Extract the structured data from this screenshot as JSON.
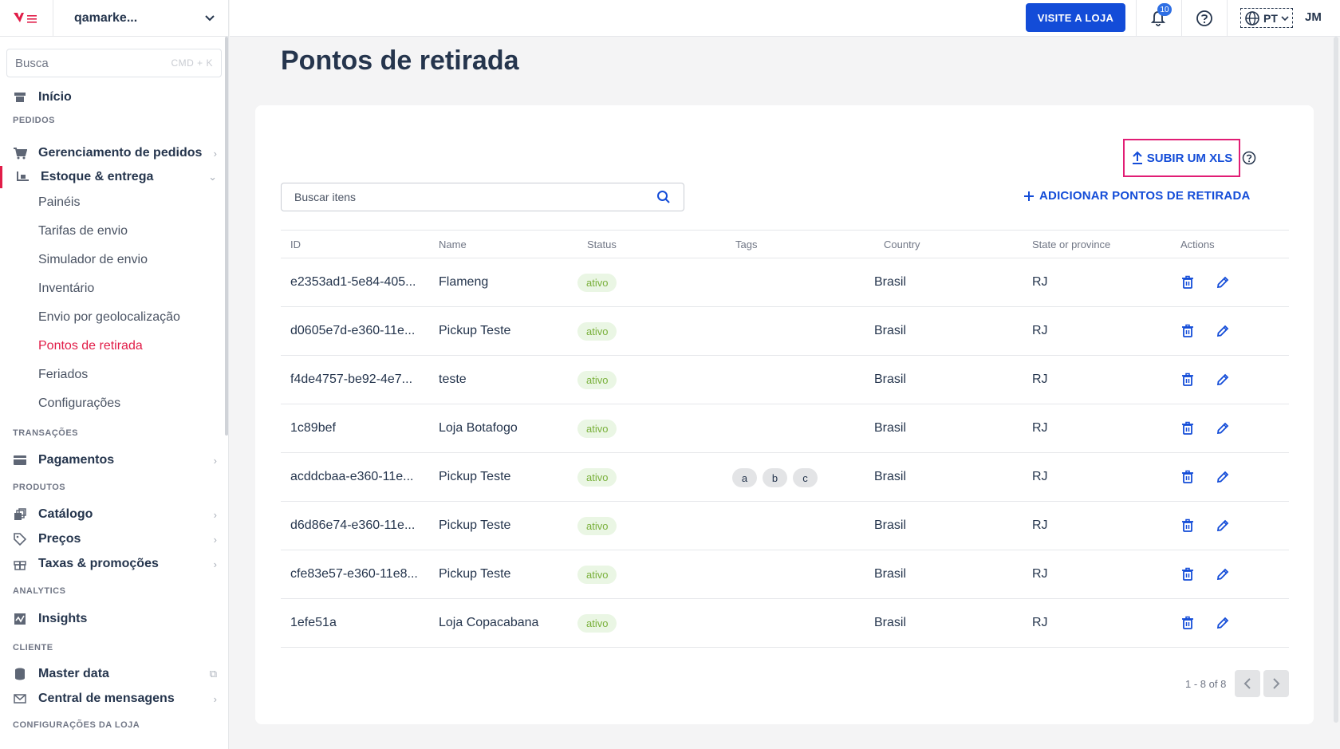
{
  "account": {
    "name": "qamarke..."
  },
  "sidebar": {
    "search_placeholder": "Busca",
    "search_shortcut": "CMD + K",
    "home": "Início",
    "sections": {
      "pedidos": "PEDIDOS",
      "transacoes": "TRANSAÇÕES",
      "produtos": "PRODUTOS",
      "analytics": "ANALYTICS",
      "cliente": "CLIENTE",
      "config_loja": "CONFIGURAÇÕES DA LOJA"
    },
    "items": {
      "orders": "Gerenciamento de pedidos",
      "stock": "Estoque & entrega",
      "payments": "Pagamentos",
      "catalog": "Catálogo",
      "prices": "Preços",
      "taxes": "Taxas & promoções",
      "insights": "Insights",
      "masterdata": "Master data",
      "messages": "Central de mensagens"
    },
    "sub_items": {
      "panels": "Painéis",
      "rates": "Tarifas de envio",
      "simulator": "Simulador de envio",
      "inventory": "Inventário",
      "geo": "Envio por geolocalização",
      "pickup": "Pontos de retirada",
      "holidays": "Feriados",
      "settings": "Configurações"
    }
  },
  "topbar": {
    "visit_store": "VISITE A LOJA",
    "notifications_count": "10",
    "language": "PT",
    "avatar": "JM"
  },
  "main": {
    "title": "Pontos de retirada",
    "upload_label": "SUBIR UM XLS",
    "search_placeholder": "Buscar itens",
    "add_label": "ADICIONAR PONTOS DE RETIRADA",
    "columns": {
      "id": "ID",
      "name": "Name",
      "status": "Status",
      "tags": "Tags",
      "country": "Country",
      "state": "State or province",
      "actions": "Actions"
    },
    "rows": [
      {
        "id": "e2353ad1-5e84-405...",
        "name": "Flameng",
        "status": "ativo",
        "tags": [],
        "country": "Brasil",
        "state": "RJ"
      },
      {
        "id": "d0605e7d-e360-11e...",
        "name": "Pickup Teste",
        "status": "ativo",
        "tags": [],
        "country": "Brasil",
        "state": "RJ"
      },
      {
        "id": "f4de4757-be92-4e7...",
        "name": "teste",
        "status": "ativo",
        "tags": [],
        "country": "Brasil",
        "state": "RJ"
      },
      {
        "id": "1c89bef",
        "name": "Loja Botafogo",
        "status": "ativo",
        "tags": [],
        "country": "Brasil",
        "state": "RJ"
      },
      {
        "id": "acddcbaa-e360-11e...",
        "name": "Pickup Teste",
        "status": "ativo",
        "tags": [
          "a",
          "b",
          "c"
        ],
        "country": "Brasil",
        "state": "RJ"
      },
      {
        "id": "d6d86e74-e360-11e...",
        "name": "Pickup Teste",
        "status": "ativo",
        "tags": [],
        "country": "Brasil",
        "state": "RJ"
      },
      {
        "id": "cfe83e57-e360-11e8...",
        "name": "Pickup Teste",
        "status": "ativo",
        "tags": [],
        "country": "Brasil",
        "state": "RJ"
      },
      {
        "id": "1efe51a",
        "name": "Loja Copacabana",
        "status": "ativo",
        "tags": [],
        "country": "Brasil",
        "state": "RJ"
      }
    ],
    "pagination": "1 - 8 of 8"
  },
  "colors": {
    "accent": "#134cd8",
    "brand": "#e11d48",
    "status_bg": "#eaf6e4",
    "status_fg": "#79b03a"
  }
}
